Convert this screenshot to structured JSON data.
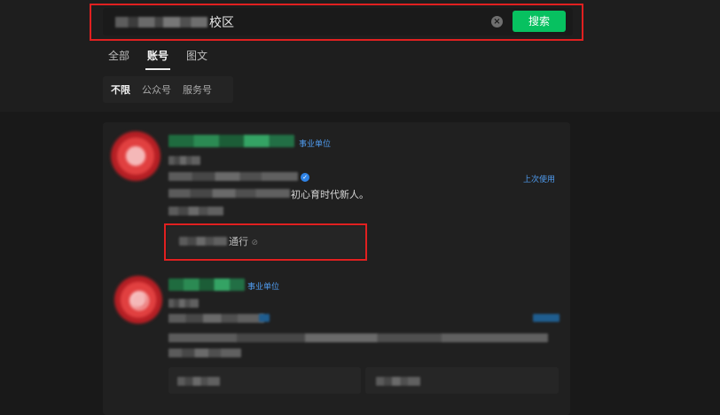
{
  "search": {
    "query_visible_suffix": "校区",
    "button_label": "搜索",
    "clear_icon": "×"
  },
  "tabs": [
    {
      "label": "全部",
      "active": false
    },
    {
      "label": "账号",
      "active": true
    },
    {
      "label": "图文",
      "active": false
    }
  ],
  "filters": [
    {
      "label": "不限",
      "active": true
    },
    {
      "label": "公众号",
      "active": false
    },
    {
      "label": "服务号",
      "active": false
    }
  ],
  "results": [
    {
      "tag": "事业单位",
      "verified_icon": "✓",
      "description_visible": "初心育时代新人。",
      "recent_label": "上次使用",
      "service": {
        "label_visible": "通行",
        "icon": "⊘"
      }
    },
    {
      "tag": "事业单位"
    }
  ],
  "colors": {
    "accent_green": "#07c160",
    "link_blue": "#4f9cf0",
    "highlight_red": "#e02020"
  }
}
